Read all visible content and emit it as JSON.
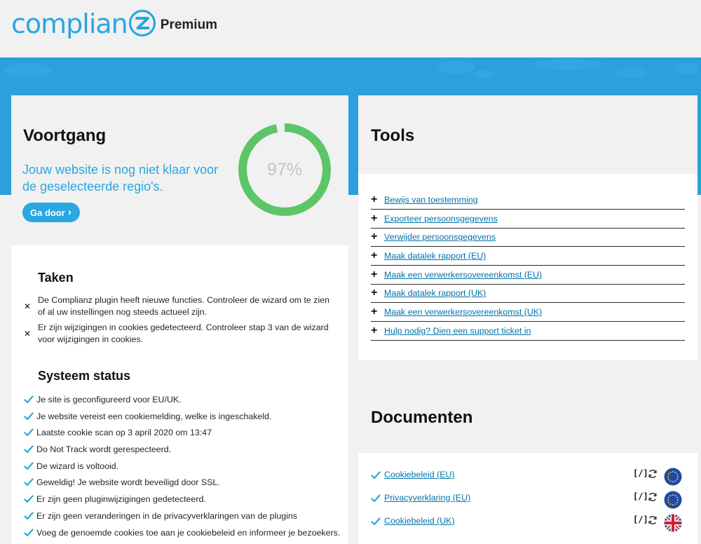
{
  "brand": {
    "logo_word": "complian",
    "logo_badge_letter": "Z",
    "edition": "Premium",
    "color": "#29a7e1"
  },
  "banner": {
    "color": "#2c9fdc"
  },
  "progress": {
    "title": "Voortgang",
    "message": "Jouw website is nog niet klaar voor de geselecteerde regio's.",
    "button_label": "Ga door",
    "percent": 97,
    "percent_label": "97%",
    "ring_color": "#5cc567",
    "track_color": "#eeeeee"
  },
  "tasks": {
    "title": "Taken",
    "items": [
      {
        "icon": "close-icon",
        "text": "De Complianz plugin heeft nieuwe functies. Controleer de wizard om te zien of al uw instellingen nog steeds actueel zijn."
      },
      {
        "icon": "close-icon",
        "text": "Er zijn wijzigingen in cookies gedetecteerd. Controleer stap 3 van de wizard voor wijzigingen in cookies."
      }
    ]
  },
  "system_status": {
    "title": "Systeem status",
    "check_color": "#29a7e1",
    "items": [
      "Je site is geconfigureerd voor EU/UK.",
      "Je website vereist een cookiemelding, welke is ingeschakeld.",
      "Laatste cookie scan op 3 april 2020 om 13:47",
      "Do Not Track wordt gerespecteerd.",
      "De wizard is voltooid.",
      "Geweldig! Je website wordt beveiligd door SSL.",
      "Er zijn geen pluginwijzigingen gedetecteerd.",
      "Er zijn geen veranderingen in de privacyverklaringen van de plugins",
      "Voeg de genoemde cookies toe aan je cookiebeleid en informeer je bezoekers."
    ]
  },
  "tools": {
    "title": "Tools",
    "items": [
      "Bewijs van toestemming",
      "Exporteer persoonsgegevens",
      "Verwijder persoonsgegevens",
      "Maak datalek rapport (EU)",
      "Maak een verwerkersovereenkomst (EU)",
      "Maak datalek rapport (UK)",
      "Maak een verwerkersovereenkomst (UK)",
      "Hulp nodig? Dien een support ticket in"
    ]
  },
  "documents": {
    "title": "Documenten",
    "items": [
      {
        "label": "Cookiebeleid (EU)",
        "shortcode": "[/]",
        "region": "eu-flag-icon"
      },
      {
        "label": "Privacyverklaring (EU)",
        "shortcode": "[/]",
        "region": "eu-flag-icon"
      },
      {
        "label": "Cookiebeleid (UK)",
        "shortcode": "[/]",
        "region": "uk-flag-icon"
      }
    ]
  }
}
